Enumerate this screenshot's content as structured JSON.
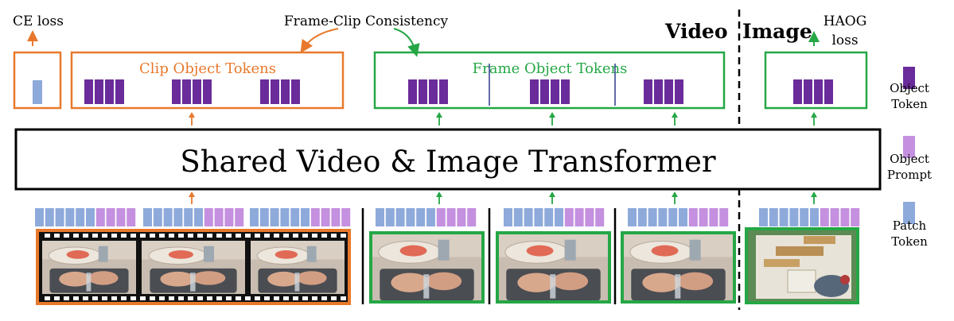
{
  "labels": {
    "ce_loss": "CE loss",
    "frame_clip": "Frame-Clip Consistency",
    "video": "Video",
    "image": "Image",
    "haog_line1": "HAOG",
    "haog_line2": "loss",
    "clip_object_tokens": "Clip Object Tokens",
    "frame_object_tokens": "Frame Object Tokens",
    "transformer": "Shared Video & Image Transformer"
  },
  "legend": [
    {
      "key": "object-token",
      "line1": "Object",
      "line2": "Token",
      "color": "#6a2c9a"
    },
    {
      "key": "object-prompt",
      "line1": "Object",
      "line2": "Prompt",
      "color": "#c490df"
    },
    {
      "key": "patch-token",
      "line1": "Patch",
      "line2": "Token",
      "color": "#8eaadb"
    }
  ],
  "colors": {
    "orange": "#e8792c",
    "green": "#25a745",
    "object_token": "#6a2c9a",
    "object_prompt": "#c490df",
    "patch_token": "#8eaadb"
  },
  "images": [
    {
      "name": "video-clip-frame-1",
      "desc": "kitchen sink hands washing"
    },
    {
      "name": "video-clip-frame-2",
      "desc": "kitchen sink hands washing"
    },
    {
      "name": "video-clip-frame-3",
      "desc": "kitchen sink hands washing"
    },
    {
      "name": "frame-1",
      "desc": "kitchen sink hands washing"
    },
    {
      "name": "frame-2",
      "desc": "kitchen sink hands washing"
    },
    {
      "name": "frame-3",
      "desc": "kitchen sink hands washing"
    },
    {
      "name": "image-sample",
      "desc": "wooden blocks on a table"
    }
  ]
}
